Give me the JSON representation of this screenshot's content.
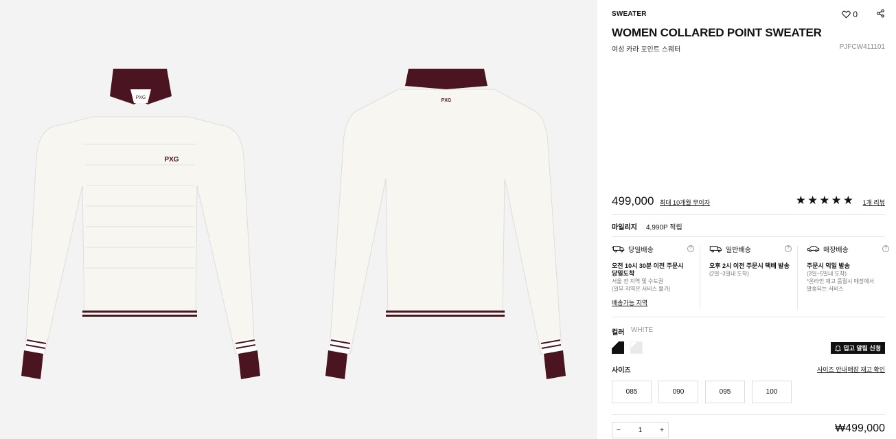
{
  "product": {
    "category": "SWEATER",
    "like_count": "0",
    "title": "WOMEN COLLARED POINT SWEATER",
    "subtitle": "여성 카라 포인트 스웨터",
    "sku": "PJFCW411101",
    "price": "499,000",
    "installment": "최대 10개월 무이자",
    "stars": "★★★★★",
    "rating": 5,
    "review_link": "1개 리뷰",
    "front_logo": "PXG"
  },
  "mileage": {
    "label": "마일리지",
    "value": "4,990P 적립"
  },
  "delivery": [
    {
      "icon": "fast-truck-icon",
      "name": "당일배송",
      "title": "오전 10시 30분 이전 주문시\n당일도착",
      "sub": "서울 전 지역 및 수도권\n(일부 지역은 서비스 불가)",
      "link": "배송가능 지역"
    },
    {
      "icon": "truck-icon",
      "name": "일반배송",
      "title": "오후 2시 이전 주문시 택배 발송",
      "sub": "(2일~3일내 도착)",
      "link": ""
    },
    {
      "icon": "car-icon",
      "name": "매장배송",
      "title": "주문시 익일 발송",
      "sub": "(3일~5일내 도착)\n*온라인 재고 품절시 매장에서\n발송되는 서비스",
      "link": ""
    }
  ],
  "color": {
    "label": "컬러",
    "selected": "WHITE",
    "swatches": [
      "black",
      "white"
    ],
    "swatch_colors": [
      "#111111",
      "#e9e9e9"
    ],
    "restock_label": "입고 알림 신청"
  },
  "size": {
    "label": "사이즈",
    "guide": "사이즈 안내",
    "store_stock": "매장 재고 확인",
    "options": [
      "085",
      "090",
      "095",
      "100"
    ]
  },
  "quantity": {
    "value": "1",
    "minus": "−",
    "plus": "+"
  },
  "total": "₩499,000",
  "colors": {
    "burgundy": "#4a1420",
    "ivory": "#f7f5f0",
    "gallery_bg": "#f3f3f3"
  }
}
